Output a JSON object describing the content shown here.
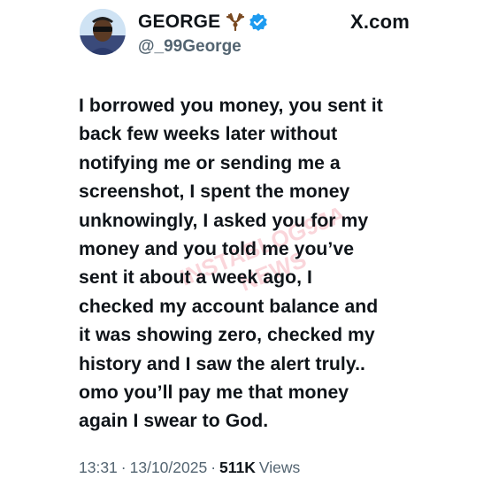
{
  "header": {
    "display_name": "GEORGE",
    "handle": "@_99George",
    "brand": "X.com",
    "icons": [
      "antler-icon",
      "verified-badge-icon"
    ],
    "verified_color": "#1d9bf0"
  },
  "tweet": {
    "text": "I borrowed you money, you sent it\nback few weeks later without\nnotifying me or sending me a\nscreenshot, I spent the money\nunknowingly, I asked you for my\nmoney and you told me you’ve\nsent it about a week ago, I\nchecked my account balance and\nit was showing zero, checked my\nhistory and I saw the alert truly..\nomo you’ll pay me that money\nagain I swear to God."
  },
  "meta": {
    "time": "13:31",
    "separator": "·",
    "date": "13/10/2025",
    "views_count": "511K",
    "views_label": "Views"
  },
  "watermark": {
    "line1": "INSTABLOG9JA",
    "line2": "NEWS"
  }
}
